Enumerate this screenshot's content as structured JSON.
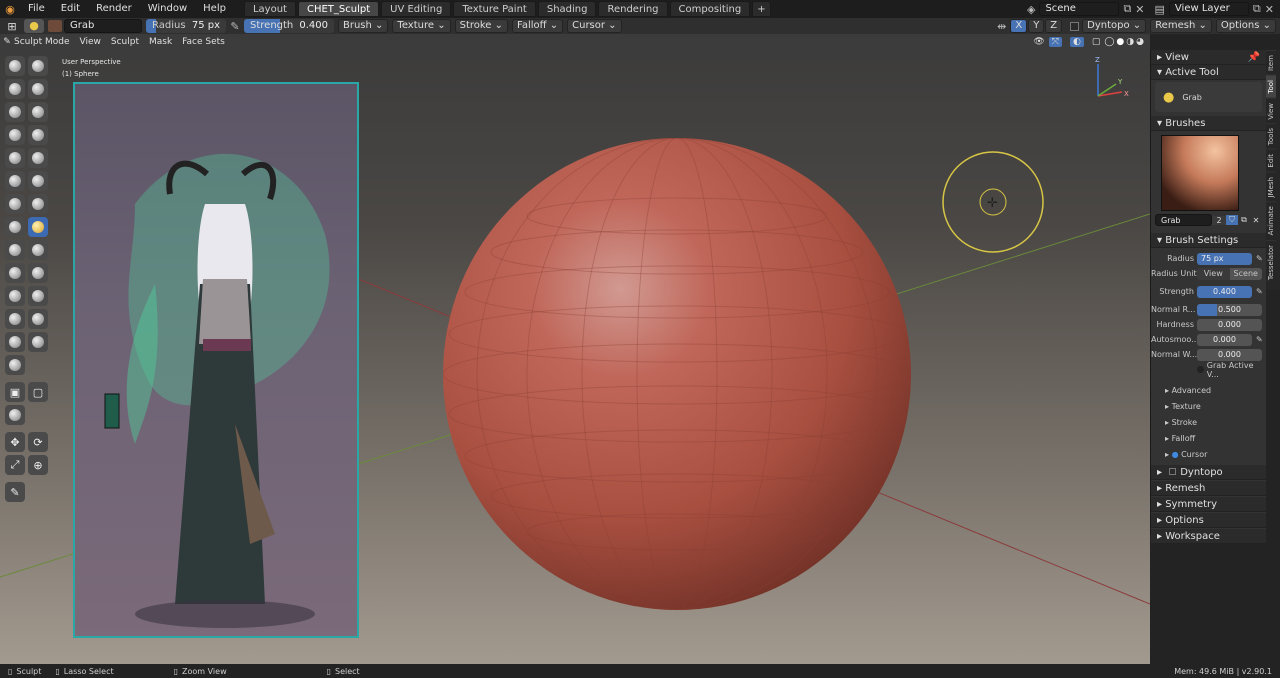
{
  "menus": [
    "File",
    "Edit",
    "Render",
    "Window",
    "Help"
  ],
  "workspace_tabs": [
    {
      "label": "Layout",
      "active": false
    },
    {
      "label": "CHET_Sculpt",
      "active": true
    },
    {
      "label": "UV Editing",
      "active": false
    },
    {
      "label": "Texture Paint",
      "active": false
    },
    {
      "label": "Shading",
      "active": false
    },
    {
      "label": "Rendering",
      "active": false
    },
    {
      "label": "Compositing",
      "active": false
    }
  ],
  "scene": "Scene",
  "view_layer": "View Layer",
  "tool_header": {
    "brush_name": "Grab",
    "radius_label": "Radius",
    "radius_value": "75 px",
    "strength_label": "Strength",
    "strength_value": "0.400",
    "dropdowns": [
      "Brush",
      "Texture",
      "Stroke",
      "Falloff",
      "Cursor"
    ],
    "axes": [
      "X",
      "Y",
      "Z"
    ],
    "right_items": [
      "Dyntopo",
      "Remesh",
      "Options"
    ]
  },
  "mode_header": {
    "mode": "Sculpt Mode",
    "menus": [
      "View",
      "Sculpt",
      "Mask",
      "Face Sets"
    ]
  },
  "viewport": {
    "overlay_line1": "User Perspective",
    "overlay_line2": "(1) Sphere",
    "gizmo_axes": [
      "Z",
      "Y",
      "X"
    ]
  },
  "n_panel": {
    "view_header": "View",
    "active_tool_header": "Active Tool",
    "active_tool_name": "Grab",
    "brushes_header": "Brushes",
    "brush_name": "Grab",
    "brush_users": "2",
    "brush_settings_header": "Brush Settings",
    "radius_label": "Radius",
    "radius_value": "75 px",
    "radius_unit_label": "Radius Unit",
    "radius_unit_options": [
      "View",
      "Scene"
    ],
    "strength_label": "Strength",
    "strength_value": "0.400",
    "normal_radius_label": "Normal R...",
    "normal_radius_value": "0.500",
    "hardness_label": "Hardness",
    "hardness_value": "0.000",
    "autosmooth_label": "Autosmoo...",
    "autosmooth_value": "0.000",
    "normal_weight_label": "Normal W...",
    "normal_weight_value": "0.000",
    "grab_active_label": "Grab Active V...",
    "subpanels": [
      "Advanced",
      "Texture",
      "Stroke",
      "Falloff",
      "Cursor"
    ],
    "sections": [
      "Dyntopo",
      "Remesh",
      "Symmetry",
      "Options",
      "Workspace"
    ]
  },
  "vertical_tabs": [
    {
      "label": "Item",
      "active": false
    },
    {
      "label": "Tool",
      "active": true
    },
    {
      "label": "View",
      "active": false
    },
    {
      "label": "Tools",
      "active": false
    },
    {
      "label": "Edit",
      "active": false
    },
    {
      "label": "JMesh",
      "active": false
    },
    {
      "label": "Animate",
      "active": false
    },
    {
      "label": "Tesselator",
      "active": false
    }
  ],
  "status_bar": {
    "left": [
      "Sculpt",
      "Lasso Select",
      "Zoom View",
      "Select"
    ],
    "right": "Mem: 49.6 MiB | v2.90.1"
  },
  "colors": {
    "accent": "#4772b3",
    "sphere": "#b0574a",
    "cursor_ring": "#d7c645"
  }
}
